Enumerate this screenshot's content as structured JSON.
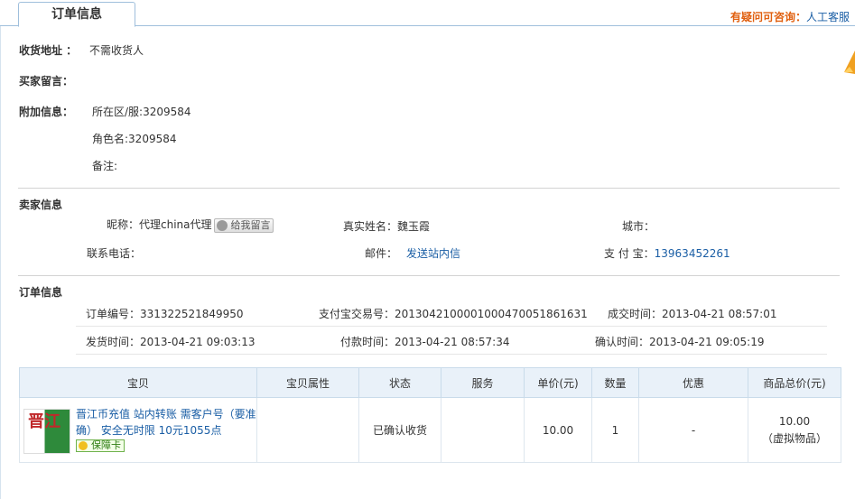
{
  "tab": {
    "title": "订单信息"
  },
  "help": {
    "label": "有疑问可咨询：",
    "link": "人工客服"
  },
  "shipping": {
    "address_label": "收货地址 ：",
    "address_value": "不需收货人",
    "buyer_msg_label": "买家留言：",
    "extra_label": "附加信息：",
    "extra_lines": [
      "所在区/服:3209584",
      "角色名:3209584",
      "备注:"
    ]
  },
  "seller": {
    "section_title": "卖家信息",
    "nickname_label": "昵称：",
    "nickname_value": "代理china代理",
    "msg_button": "给我留言",
    "realname_label": "真实姓名：",
    "realname_value": "魏玉霞",
    "city_label": "城市：",
    "city_value": "",
    "phone_label": "联系电话：",
    "phone_value": "",
    "mail_label": "邮件：",
    "mail_link": "发送站内信",
    "alipay_label": "支 付 宝：",
    "alipay_value": "13963452261"
  },
  "order": {
    "section_title": "订单信息",
    "order_no_label": "订单编号：",
    "order_no_value": "331322521849950",
    "trade_no_label": "支付宝交易号：",
    "trade_no_value": "2013042100001000470051861631",
    "deal_time_label": "成交时间：",
    "deal_time_value": "2013-04-21 08:57:01",
    "ship_time_label": "发货时间：",
    "ship_time_value": "2013-04-21 09:03:13",
    "pay_time_label": "付款时间：",
    "pay_time_value": "2013-04-21 08:57:34",
    "confirm_time_label": "确认时间：",
    "confirm_time_value": "2013-04-21 09:05:19"
  },
  "table": {
    "headers": [
      "宝贝",
      "宝贝属性",
      "状态",
      "服务",
      "单价(元)",
      "数量",
      "优惠",
      "商品总价(元)"
    ],
    "row": {
      "thumb_text": "晋江",
      "title": "晋江币充值 站内转账 需客户号（要准确） 安全无时限 10元1055点",
      "badge": "保障卡",
      "attr": "",
      "status": "已确认收货",
      "service": "",
      "price": "10.00",
      "qty": "1",
      "discount": "-",
      "total": "10.00",
      "total_note": "（虚拟物品）"
    }
  }
}
